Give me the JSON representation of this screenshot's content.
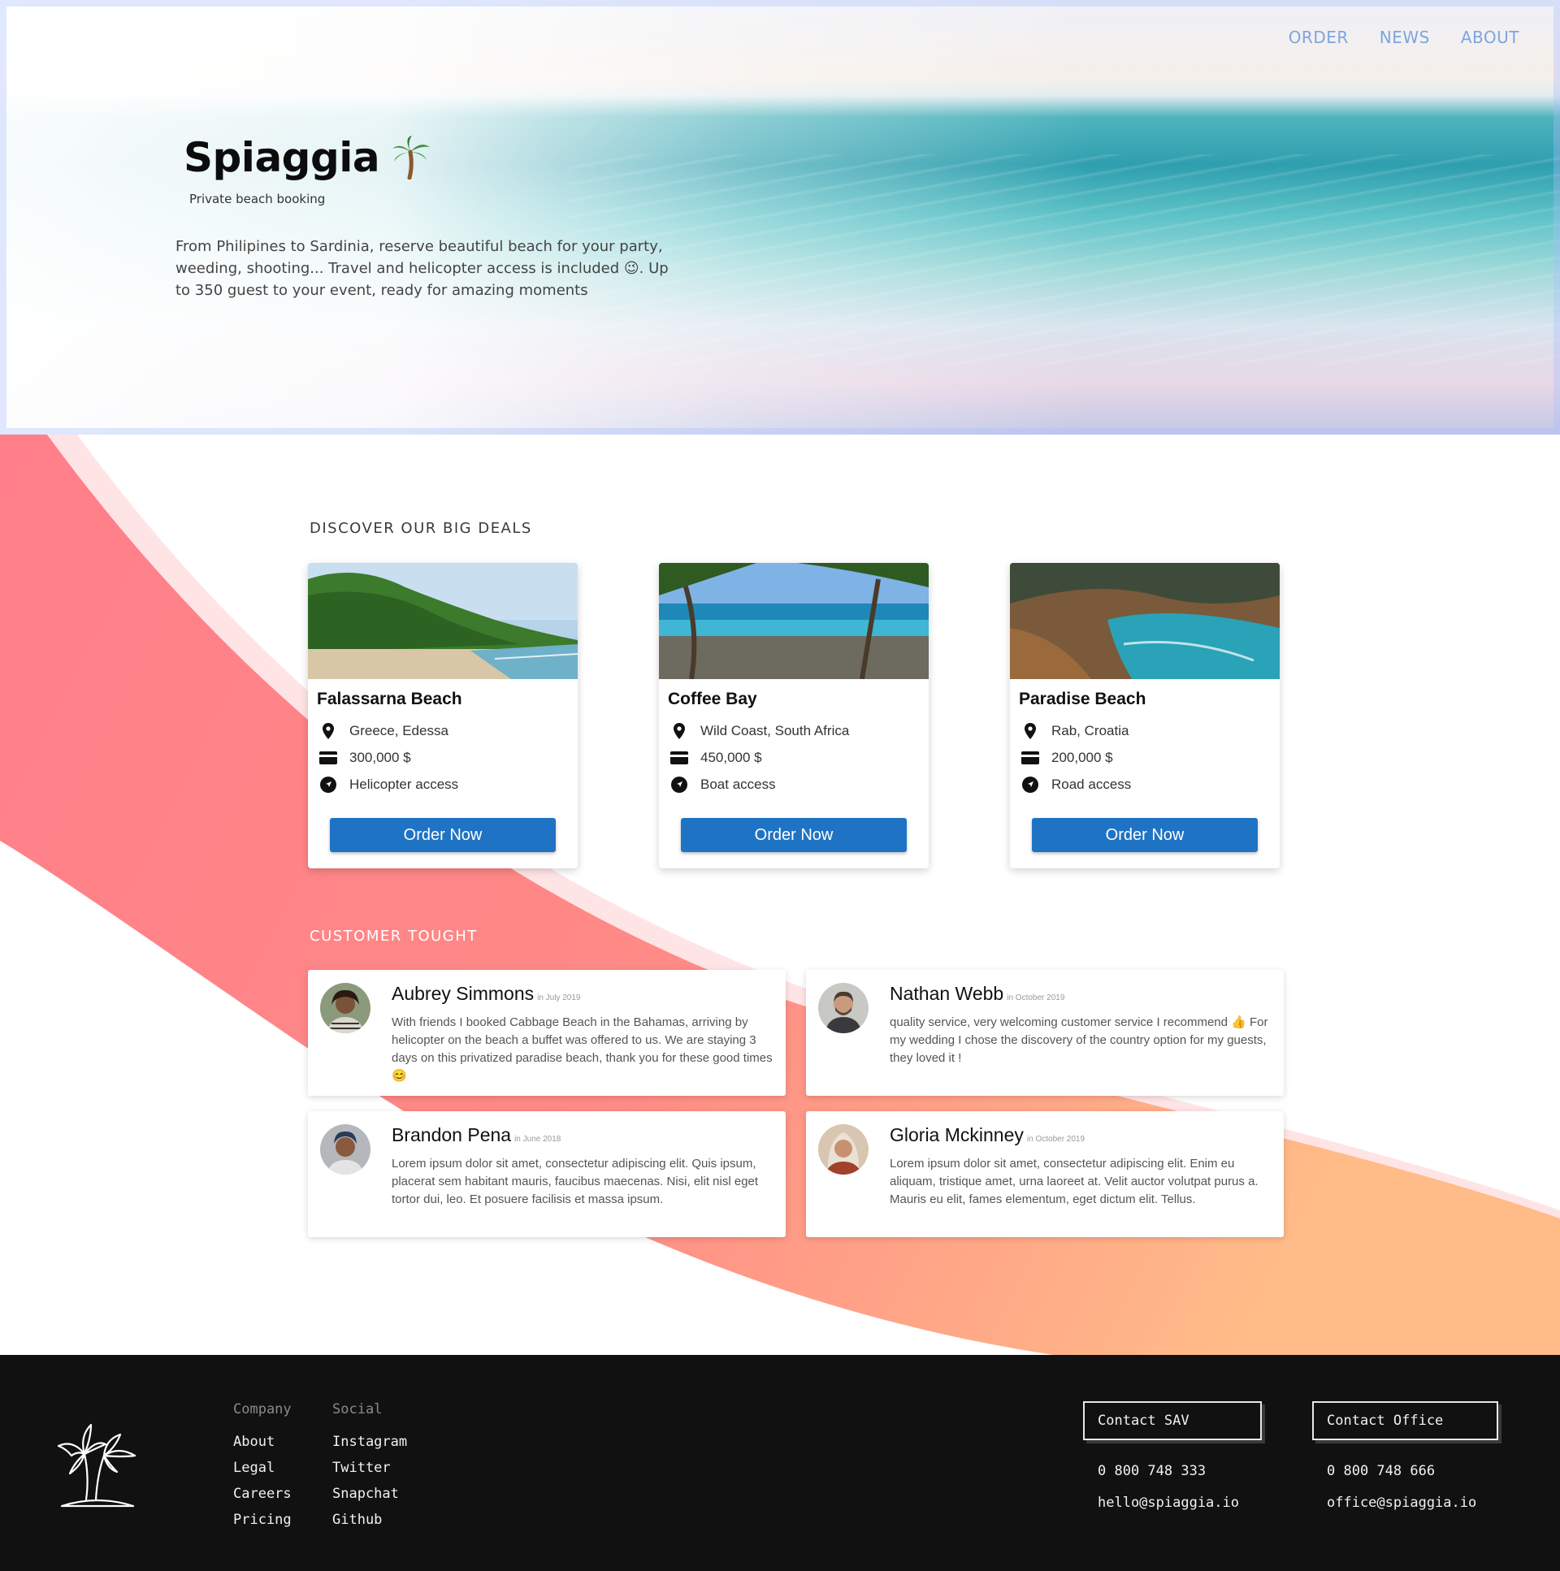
{
  "nav": {
    "items": [
      "ORDER",
      "NEWS",
      "ABOUT"
    ]
  },
  "hero": {
    "title": "Spiaggia",
    "subtitle": "Private beach booking",
    "description": "From Philipines to Sardinia, reserve beautiful beach for your party, weeding, shooting... Travel and helicopter access is included 😉. Up to 350 guest to your event, ready for amazing moments"
  },
  "deals": {
    "title": "DISCOVER OUR BIG DEALS",
    "cards": [
      {
        "name": "Falassarna Beach",
        "location": "Greece, Edessa",
        "price": "300,000 $",
        "access": "Helicopter access",
        "button": "Order Now"
      },
      {
        "name": "Coffee Bay",
        "location": "Wild Coast, South Africa",
        "price": "450,000 $",
        "access": "Boat access",
        "button": "Order Now"
      },
      {
        "name": "Paradise Beach",
        "location": "Rab, Croatia",
        "price": "200,000 $",
        "access": "Road access",
        "button": "Order Now"
      }
    ]
  },
  "reviews": {
    "title": "CUSTOMER TOUGHT",
    "items": [
      {
        "name": "Aubrey Simmons",
        "date": "in July 2019",
        "text": "With friends I booked Cabbage Beach in the Bahamas, arriving by helicopter on the beach a buffet was offered to us. We are staying 3 days on this privatized paradise beach, thank you for these good times 😊"
      },
      {
        "name": "Nathan Webb",
        "date": "in October 2019",
        "text": "quality service, very welcoming customer service I recommend 👍 For my wedding I chose the discovery of the country option for my guests, they loved it !"
      },
      {
        "name": "Brandon Pena",
        "date": "in June 2018",
        "text": "Lorem ipsum dolor sit amet, consectetur adipiscing elit. Quis ipsum, placerat sem habitant mauris, faucibus maecenas. Nisi, elit nisl eget tortor dui, leo. Et posuere facilisis et massa ipsum."
      },
      {
        "name": "Gloria Mckinney",
        "date": "in October 2019",
        "text": "Lorem ipsum dolor sit amet, consectetur adipiscing elit. Enim eu aliquam, tristique amet, urna laoreet at. Velit auctor volutpat purus a. Mauris eu elit, fames elementum, eget dictum elit. Tellus."
      }
    ]
  },
  "footer": {
    "company": {
      "title": "Company",
      "links": [
        "About",
        "Legal",
        "Careers",
        "Pricing"
      ]
    },
    "social": {
      "title": "Social",
      "links": [
        "Instagram",
        "Twitter",
        "Snapchat",
        "Github"
      ]
    },
    "contact_sav": {
      "label": "Contact SAV",
      "phone": "0 800 748 333",
      "email": "hello@spiaggia.io"
    },
    "contact_office": {
      "label": "Contact Office",
      "phone": "0 800 748 666",
      "email": "office@spiaggia.io"
    }
  },
  "colors": {
    "accent": "#1f73c4",
    "nav": "#7fa4de",
    "footer_bg": "#111111",
    "swoosh_from": "#ff7e8a",
    "swoosh_to": "#ffbb88"
  },
  "icons": [
    "palm-tree-icon",
    "location-pin-icon",
    "credit-card-icon",
    "compass-icon"
  ]
}
